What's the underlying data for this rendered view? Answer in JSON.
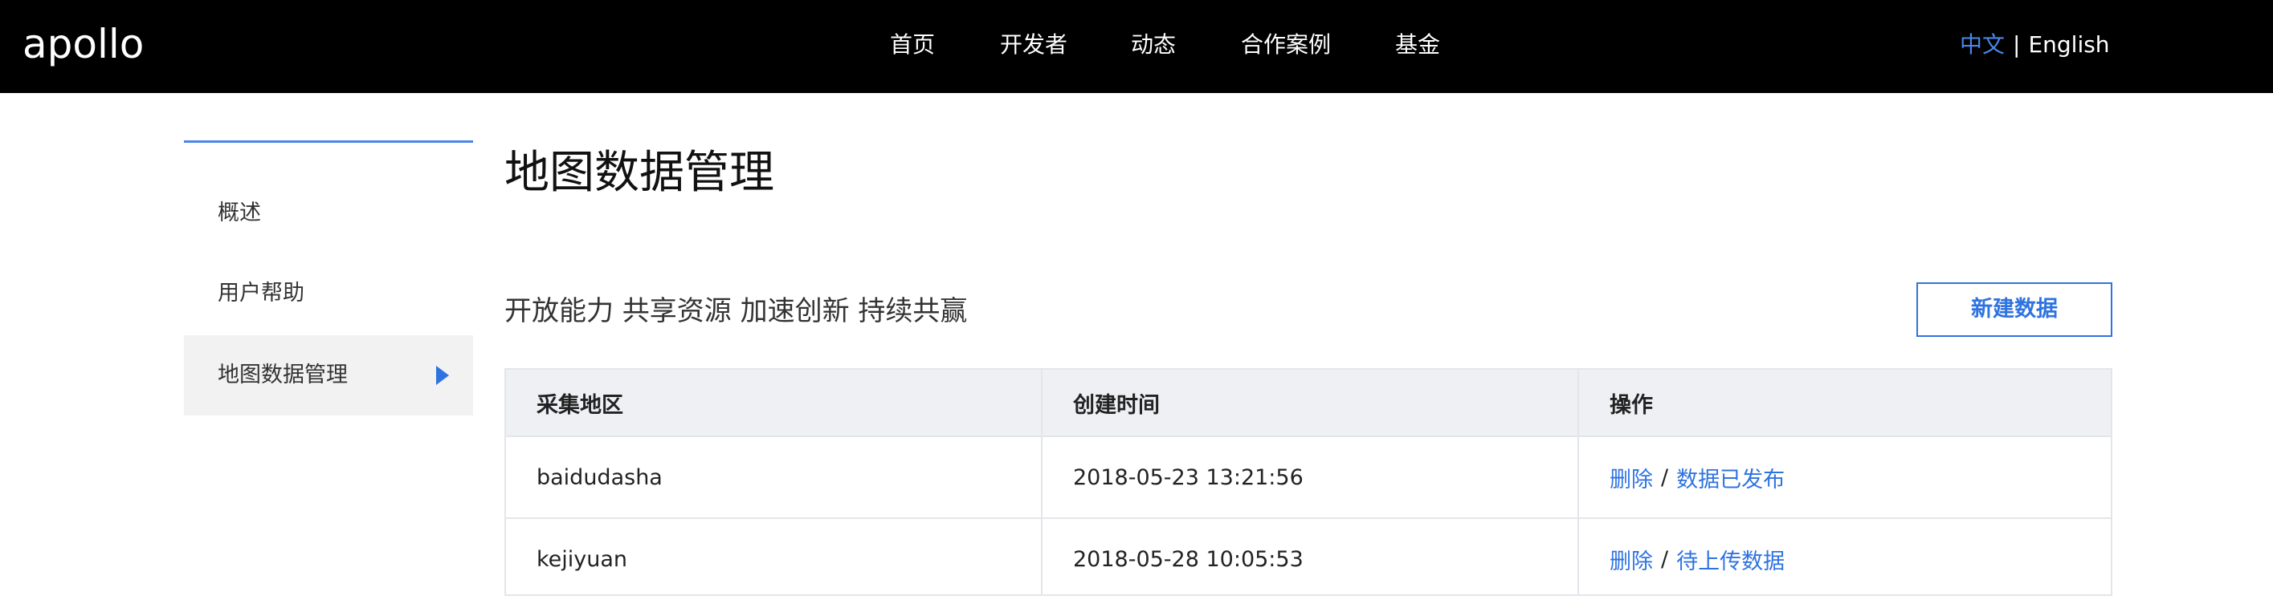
{
  "header": {
    "logo_text": "apollo",
    "nav": [
      "首页",
      "开发者",
      "动态",
      "合作案例",
      "基金"
    ],
    "lang_zh": "中文",
    "lang_sep": "|",
    "lang_en": "English"
  },
  "sidebar": {
    "items": [
      {
        "label": "概述"
      },
      {
        "label": "用户帮助"
      },
      {
        "label": "地图数据管理",
        "active": true
      }
    ]
  },
  "main": {
    "title": "地图数据管理",
    "slogan": "开放能力 共享资源 加速创新 持续共赢",
    "new_button": "新建数据",
    "table": {
      "columns": [
        "采集地区",
        "创建时间",
        "操作"
      ],
      "rows": [
        {
          "region": "baidudasha",
          "created": "2018-05-23 13:21:56",
          "action_delete": "删除",
          "action_sep": "/",
          "action_status": "数据已发布"
        },
        {
          "region": "kejiyuan",
          "created": "2018-05-28 10:05:53",
          "action_delete": "删除",
          "action_sep": "/",
          "action_status": "待上传数据"
        }
      ]
    }
  },
  "colors": {
    "accent": "#2f73e0",
    "topbar": "#000000",
    "table_header_bg": "#eff0f4",
    "sidebar_active_bg": "#f2f2f2"
  }
}
